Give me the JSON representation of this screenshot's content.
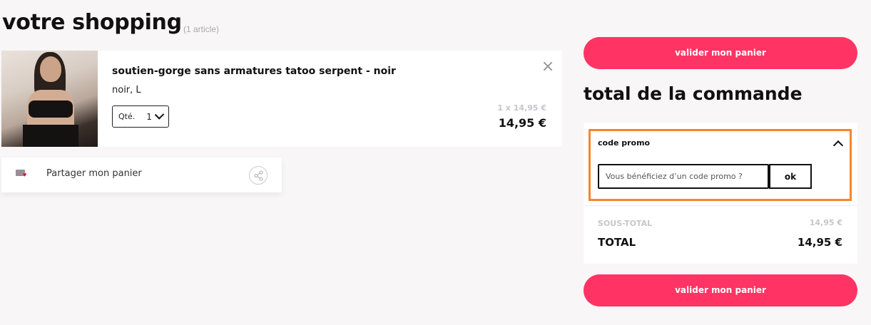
{
  "header": {
    "title": "votre shopping",
    "article_count": "(1 article)"
  },
  "cart": {
    "items": [
      {
        "name": "soutien-gorge sans armatures tatoo serpent - noir",
        "variant": "noir, L",
        "qty_label": "Qté.",
        "qty_value": "1",
        "unit_price": "1 x 14,95 €",
        "line_total": "14,95 €",
        "image_icon": "product-photo"
      }
    ],
    "share_label": "Partager mon panier"
  },
  "summary": {
    "cta_label": "valider mon panier",
    "title": "total de la commande",
    "promo": {
      "header": "code promo",
      "placeholder": "Vous bénéficiez d’un code promo ?",
      "submit_label": "ok"
    },
    "subtotal_label": "SOUS-TOTAL",
    "subtotal_value": "14,95 €",
    "total_label": "TOTAL",
    "total_value": "14,95 €"
  },
  "colors": {
    "accent": "#ff3464",
    "highlight_border": "#f5852e",
    "background": "#f8f6f6"
  }
}
